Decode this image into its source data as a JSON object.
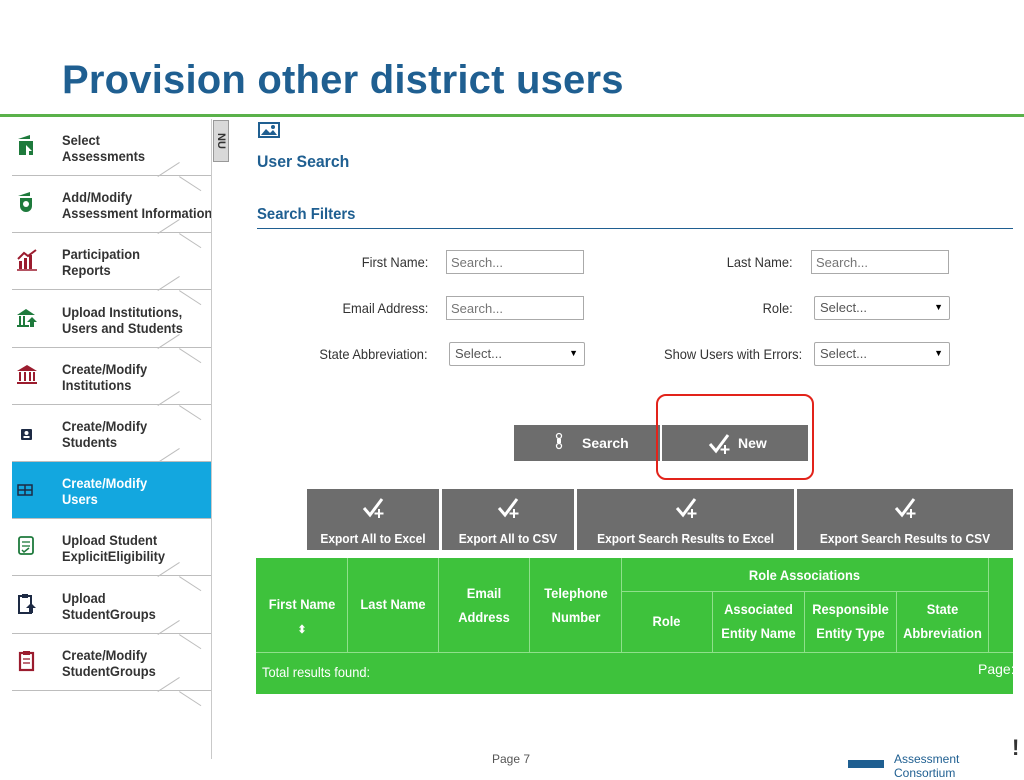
{
  "slide": {
    "title": "Provision other district users",
    "page_footer": "Page 7",
    "org_footer": "Assessment Consortium"
  },
  "sidebar": {
    "collapse_label": "NU",
    "items": [
      {
        "label": "Select\nAssessments",
        "icon": "assessment-upload-icon",
        "color": "#1e7a3c"
      },
      {
        "label": "Add/Modify\nAssessment Information",
        "icon": "assessment-shield-icon",
        "color": "#1e7a3c"
      },
      {
        "label": "Participation\nReports",
        "icon": "chart-report-icon",
        "color": "#9b1c2e"
      },
      {
        "label": "Upload Institutions,\nUsers and Students",
        "icon": "upload-institution-icon",
        "color": "#1e7a3c"
      },
      {
        "label": "Create/Modify\nInstitutions",
        "icon": "institution-icon",
        "color": "#9b1c2e"
      },
      {
        "label": "Create/Modify\nStudents",
        "icon": "student-icon",
        "color": "#1d2a44"
      },
      {
        "label": "Create/Modify\nUsers",
        "icon": "users-icon",
        "color": "#1d2a44",
        "active": true
      },
      {
        "label": "Upload Student\nExplicitEligibility",
        "icon": "eligibility-doc-icon",
        "color": "#1e7a3c"
      },
      {
        "label": "Upload\nStudentGroups",
        "icon": "clipboard-upload-icon",
        "color": "#1d2a44"
      },
      {
        "label": "Create/Modify\nStudentGroups",
        "icon": "clipboard-icon",
        "color": "#9b1c2e"
      }
    ]
  },
  "main": {
    "image_icon": "image-icon",
    "title": "User Search",
    "filters_title": "Search Filters",
    "filters": {
      "first_name_label": "First Name:",
      "first_name_placeholder": "Search...",
      "last_name_label": "Last Name:",
      "last_name_placeholder": "Search...",
      "email_label": "Email Address:",
      "email_placeholder": "Search...",
      "role_label": "Role:",
      "role_value": "Select...",
      "state_label": "State Abbreviation:",
      "state_value": "Select...",
      "errors_label": "Show Users with Errors:",
      "errors_value": "Select..."
    },
    "buttons": {
      "search": "Search",
      "new": "New"
    },
    "exports": [
      "Export All to Excel",
      "Export All to CSV",
      "Export Search Results to Excel",
      "Export Search Results to CSV"
    ],
    "table": {
      "headers": {
        "first_name": "First Name",
        "sort_glyph": "⬍",
        "last_name": "Last Name",
        "email": "Email\nAddress",
        "telephone": "Telephone\nNumber",
        "role_associations": "Role Associations",
        "role": "Role",
        "associated_entity": "Associated\nEntity Name",
        "responsible_entity": "Responsible\nEntity Type",
        "state_abbr": "State\nAbbreviation"
      },
      "total_label": "Total results found:",
      "page_label": "Page:"
    }
  },
  "colors": {
    "title": "#1f5f91",
    "accent_green": "#3ec23c",
    "active_blue": "#13a7df",
    "button_gray": "#6d6d6d",
    "highlight_red": "#e2231a"
  }
}
